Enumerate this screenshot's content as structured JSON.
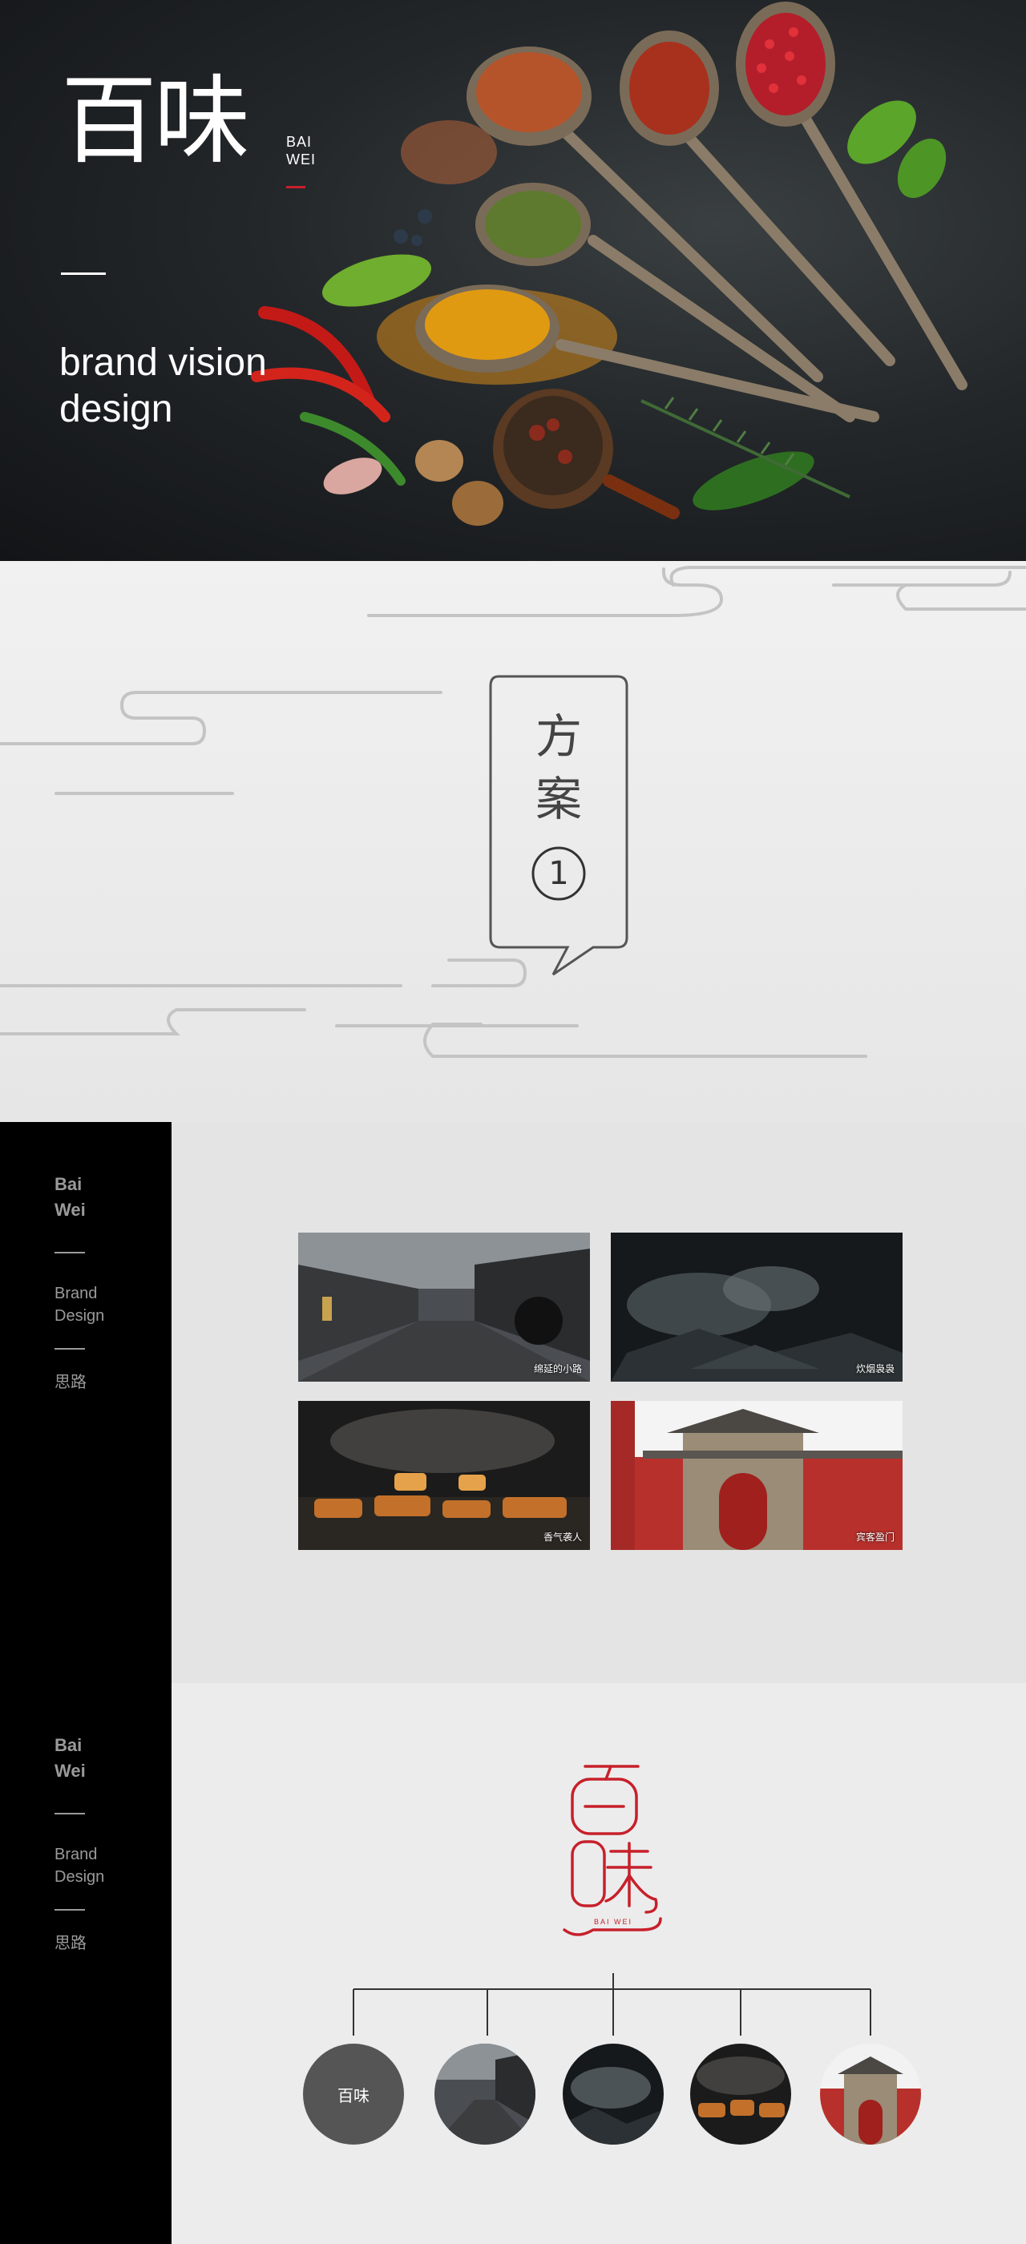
{
  "hero": {
    "brand_cn": "百味",
    "brand_en_line1": "BAI",
    "brand_en_line2": "WEI",
    "tagline_line1": "brand vision",
    "tagline_line2": "design"
  },
  "plan": {
    "title_line1": "方",
    "title_line2": "案",
    "number": "1"
  },
  "sidebar": {
    "brand_line1": "Bai",
    "brand_line2": "Wei",
    "sub_line1": "Brand",
    "sub_line2": "Design",
    "note": "思路"
  },
  "gallery": [
    {
      "caption": "绵延的小路"
    },
    {
      "caption": "炊烟袅袅"
    },
    {
      "caption": "香气袭人"
    },
    {
      "caption": "宾客盈门"
    }
  ],
  "logo": {
    "mark_cn": "百味",
    "mark_en": "BAI WEI"
  },
  "tree": {
    "root_label": "百味"
  },
  "colors": {
    "brand_red": "#c7202b",
    "sidebar_black": "#000000",
    "panel_grey": "#e4e4e4"
  }
}
